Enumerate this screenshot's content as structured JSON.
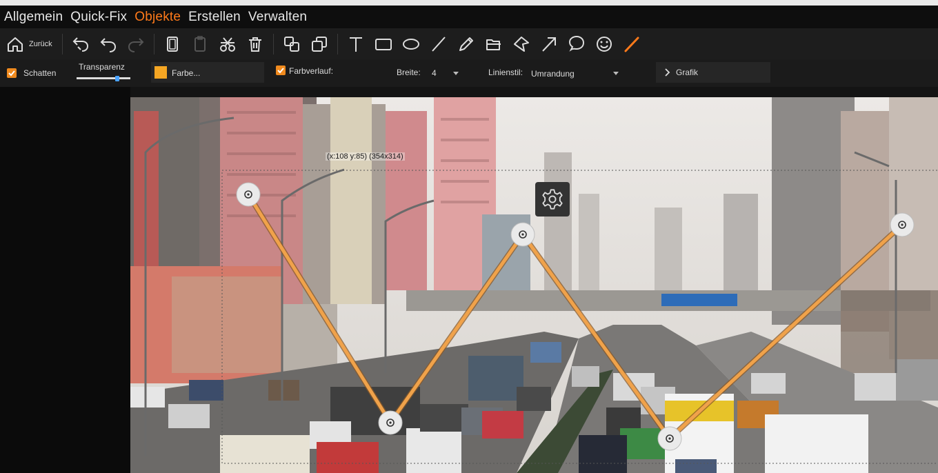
{
  "menu": [
    "Allgemein",
    "Quick-Fix",
    "Objekte",
    "Erstellen",
    "Verwalten"
  ],
  "active_menu": "Objekte",
  "toolbar": {
    "back_label": "Zurück",
    "tools": [
      "undo-history-icon",
      "undo-icon",
      "redo-icon",
      "copy-icon",
      "paste-icon",
      "cut-icon",
      "delete-icon",
      "group-icon",
      "ungroup-icon",
      "text-icon",
      "rectangle-icon",
      "ellipse-icon",
      "line-icon",
      "pencil-icon",
      "polygon-icon",
      "freeform-icon",
      "arrow-icon",
      "speech-bubble-icon",
      "smiley-icon",
      "polyline-icon"
    ],
    "active_tool": "polyline-icon"
  },
  "props": {
    "schatten_label": "Schatten",
    "schatten_checked": true,
    "transparenz_label": "Transparenz",
    "transparenz_value": 0.75,
    "farbe_label": "Farbe...",
    "farbe_color": "#f5a623",
    "farbverlauf_label": "Farbverlauf:",
    "farbverlauf_checked": true,
    "breite_label": "Breite:",
    "breite_value": "4",
    "linienstil_label": "Linienstil:",
    "linienstil_value": "Umrandung",
    "grafik_label": "Grafik"
  },
  "selection_info": "(x:108 y:85) (354x314)",
  "colors": {
    "accent": "#ff7a1a",
    "line": "#f0a24a",
    "checkbox": "#f08a1e"
  }
}
